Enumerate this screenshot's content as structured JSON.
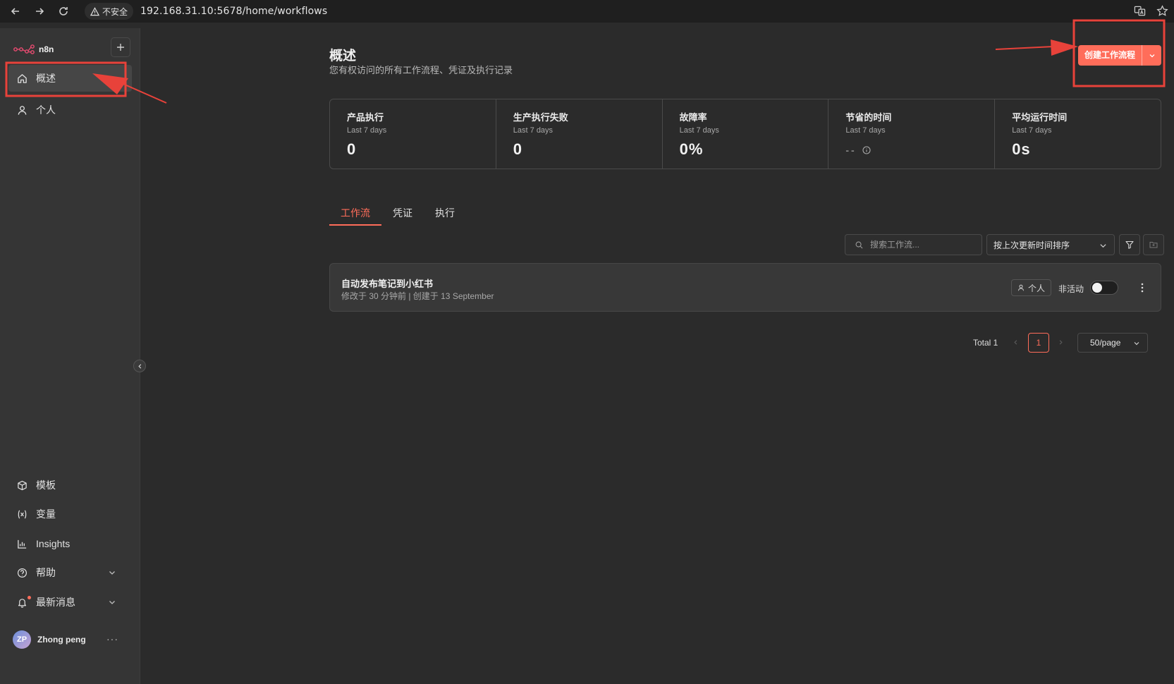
{
  "browser": {
    "insecure_label": "不安全",
    "url": "192.168.31.10:5678/home/workflows"
  },
  "sidebar": {
    "brand": "n8n",
    "top_items": [
      {
        "label": "概述",
        "icon": "home-icon",
        "active": true
      },
      {
        "label": "个人",
        "icon": "user-icon",
        "active": false
      }
    ],
    "bottom_items": [
      {
        "label": "模板",
        "icon": "box-icon"
      },
      {
        "label": "变量",
        "icon": "variable-icon"
      },
      {
        "label": "Insights",
        "icon": "chart-icon"
      },
      {
        "label": "帮助",
        "icon": "help-icon"
      },
      {
        "label": "最新消息",
        "icon": "bell-icon"
      }
    ],
    "user": {
      "initials": "ZP",
      "name": "Zhong peng",
      "more": "···"
    }
  },
  "header": {
    "title": "概述",
    "subtitle": "您有权访问的所有工作流程、凭证及执行记录",
    "create_button": "创建工作流程"
  },
  "stats": [
    {
      "title": "产品执行",
      "period": "Last 7 days",
      "value": "0"
    },
    {
      "title": "生产执行失败",
      "period": "Last 7 days",
      "value": "0"
    },
    {
      "title": "故障率",
      "period": "Last 7 days",
      "value": "0%"
    },
    {
      "title": "节省的时间",
      "period": "Last 7 days",
      "value": "--"
    },
    {
      "title": "平均运行时间",
      "period": "Last 7 days",
      "value": "0s"
    }
  ],
  "tabs": [
    {
      "label": "工作流",
      "active": true
    },
    {
      "label": "凭证",
      "active": false
    },
    {
      "label": "执行",
      "active": false
    }
  ],
  "toolbar": {
    "search_placeholder": "搜索工作流...",
    "sort_value": "按上次更新时间排序"
  },
  "workflows": [
    {
      "name": "自动发布笔记到小红书",
      "meta": "修改于 30 分钟前 | 创建于 13 September",
      "owner": "个人",
      "status": "非活动",
      "active": false
    }
  ],
  "pagination": {
    "total": "Total 1",
    "current_page": "1",
    "page_size": "50/page"
  },
  "colors": {
    "accent": "#ff6d5a",
    "annotation": "#e8423a",
    "background": "#2b2b2b",
    "sidebar": "#353535"
  }
}
